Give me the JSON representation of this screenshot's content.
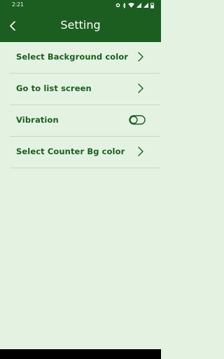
{
  "status_bar": {
    "time": "2:21",
    "icons": [
      "gear-icon",
      "bluetooth-icon",
      "wifi-icon",
      "signal-icon",
      "signal-icon",
      "battery-icon"
    ]
  },
  "app_bar": {
    "title": "Setting",
    "back_icon": "back-arrow-icon"
  },
  "settings": {
    "items": [
      {
        "label": "Select Background color",
        "control": "chevron"
      },
      {
        "label": "Go to list screen",
        "control": "chevron"
      },
      {
        "label": "Vibration",
        "control": "toggle",
        "toggle_on": false
      },
      {
        "label": "Select Counter Bg color",
        "control": "chevron"
      }
    ]
  },
  "colors": {
    "primary": "#1b5e20",
    "background": "#e4f3e1",
    "divider": "#c9d6c6"
  }
}
